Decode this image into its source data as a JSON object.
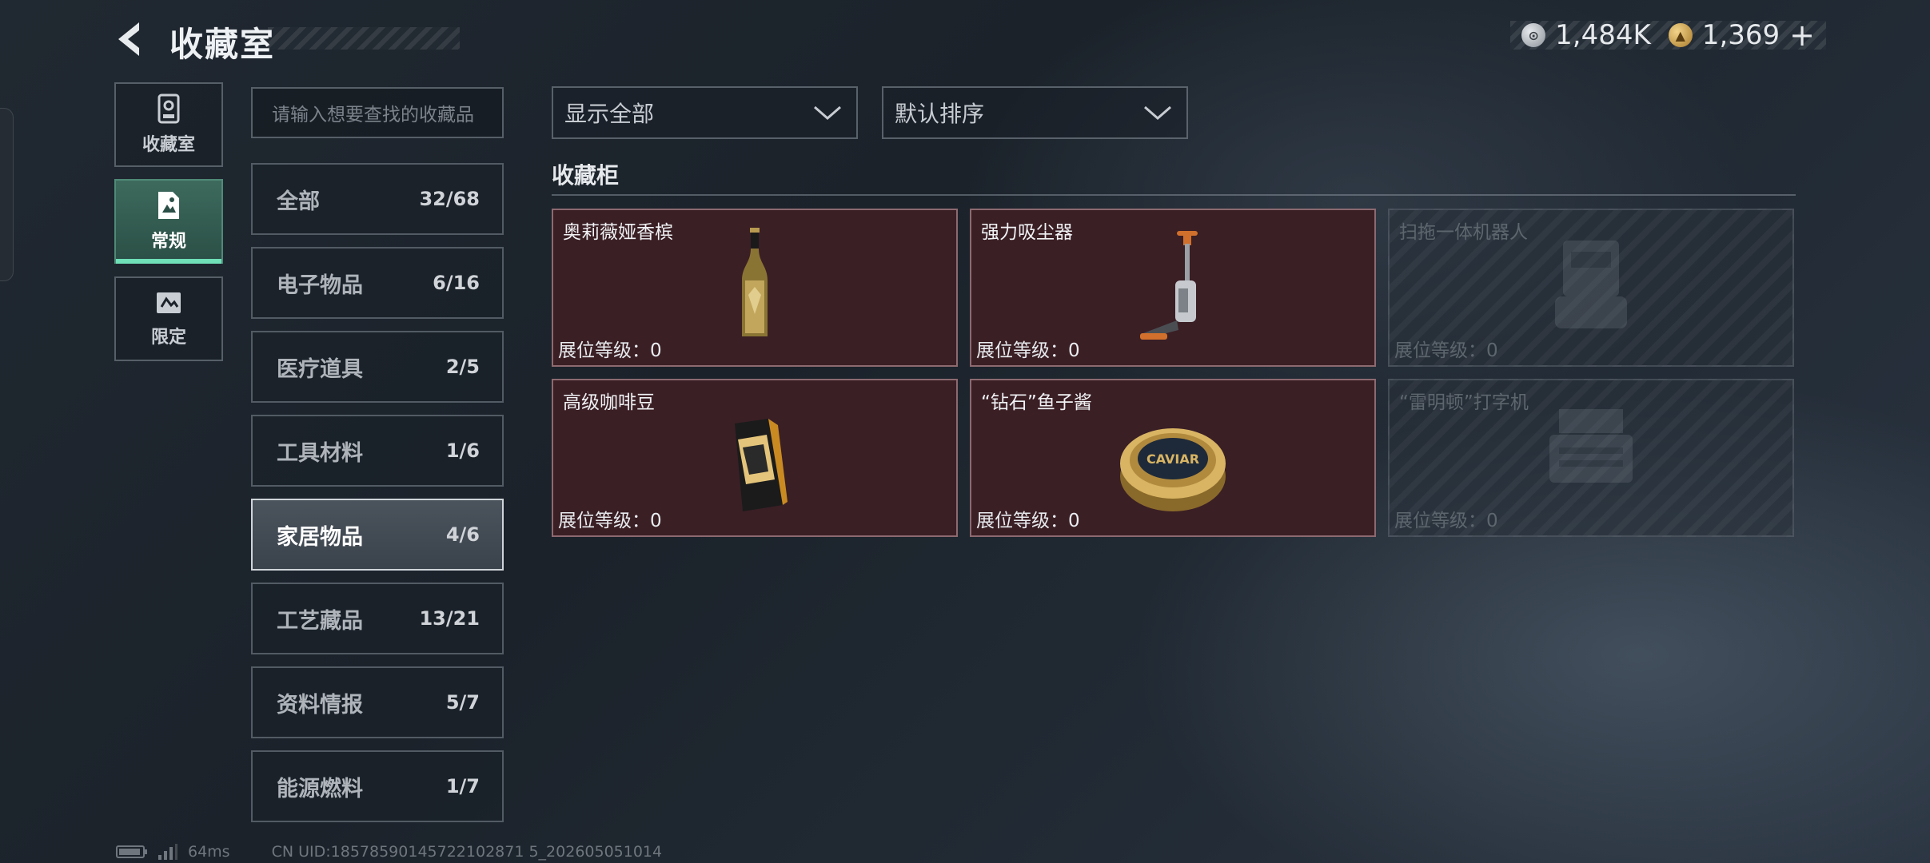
{
  "header": {
    "title": "收藏室",
    "back_icon": "back-arrow-icon"
  },
  "currency": {
    "silver": {
      "value": "1,484K",
      "icon": "silver-coin-icon",
      "color": "#b9bfc6"
    },
    "gold": {
      "value": "1,369",
      "icon": "gold-coin-icon",
      "color": "#c8a04a"
    },
    "add_label": "+"
  },
  "nav": {
    "items": [
      {
        "label": "收藏室",
        "icon": "trophy-icon",
        "active": false
      },
      {
        "label": "常规",
        "icon": "document-icon",
        "active": true
      },
      {
        "label": "限定",
        "icon": "ticket-icon",
        "active": false
      }
    ]
  },
  "search": {
    "placeholder": "请输入想要查找的收藏品"
  },
  "categories": [
    {
      "name": "全部",
      "count": "32/68"
    },
    {
      "name": "电子物品",
      "count": "6/16"
    },
    {
      "name": "医疗道具",
      "count": "2/5"
    },
    {
      "name": "工具材料",
      "count": "1/6"
    },
    {
      "name": "家居物品",
      "count": "4/6",
      "active": true
    },
    {
      "name": "工艺藏品",
      "count": "13/21"
    },
    {
      "name": "资料情报",
      "count": "5/7"
    },
    {
      "name": "能源燃料",
      "count": "1/7"
    }
  ],
  "filters": {
    "display": "显示全部",
    "sort": "默认排序"
  },
  "cabinet": {
    "title": "收藏柜",
    "items": [
      {
        "name": "奥莉薇娅香槟",
        "level": "展位等级：0",
        "owned": true,
        "icon": "champagne-bottle-icon"
      },
      {
        "name": "强力吸尘器",
        "level": "展位等级：0",
        "owned": true,
        "icon": "vacuum-cleaner-icon"
      },
      {
        "name": "扫拖一体机器人",
        "level": "展位等级：0",
        "owned": false,
        "icon": "robot-vacuum-icon"
      },
      {
        "name": "高级咖啡豆",
        "level": "展位等级：0",
        "owned": true,
        "icon": "coffee-bag-icon"
      },
      {
        "name": "“钻石”鱼子酱",
        "level": "展位等级：0",
        "owned": true,
        "icon": "caviar-tin-icon",
        "tin_text": "CAVIAR"
      },
      {
        "name": "“雷明顿”打字机",
        "level": "展位等级：0",
        "owned": false,
        "icon": "typewriter-icon"
      }
    ]
  },
  "footer": {
    "ping": "64ms",
    "uid": "CN UID:18578590145722102871 5_202605051014"
  }
}
